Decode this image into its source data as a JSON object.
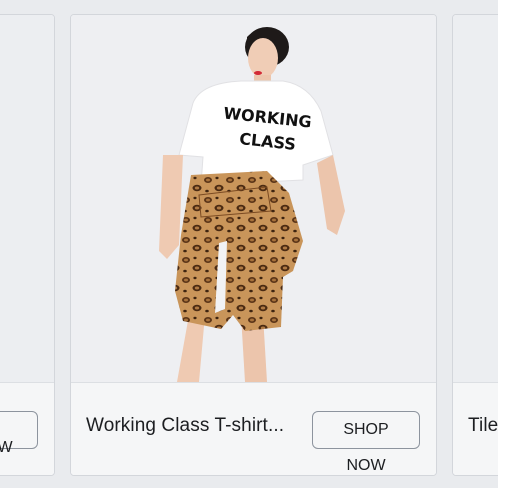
{
  "carousel": {
    "left_card": {
      "button_label": "SHOP NOW",
      "button_label_visible": "OW"
    },
    "main_card": {
      "title": "Working Class T-shirt...",
      "button_label": "SHOP NOW",
      "shirt_print_line1": "WORKING",
      "shirt_print_line2": "CLASS"
    },
    "right_card": {
      "title_visible": "Tile"
    }
  },
  "colors": {
    "page_background": "#e9ebee",
    "card_background": "#ffffff",
    "footer_background": "#f5f6f7",
    "button_border": "#8d949e",
    "text": "#1c1e21"
  }
}
